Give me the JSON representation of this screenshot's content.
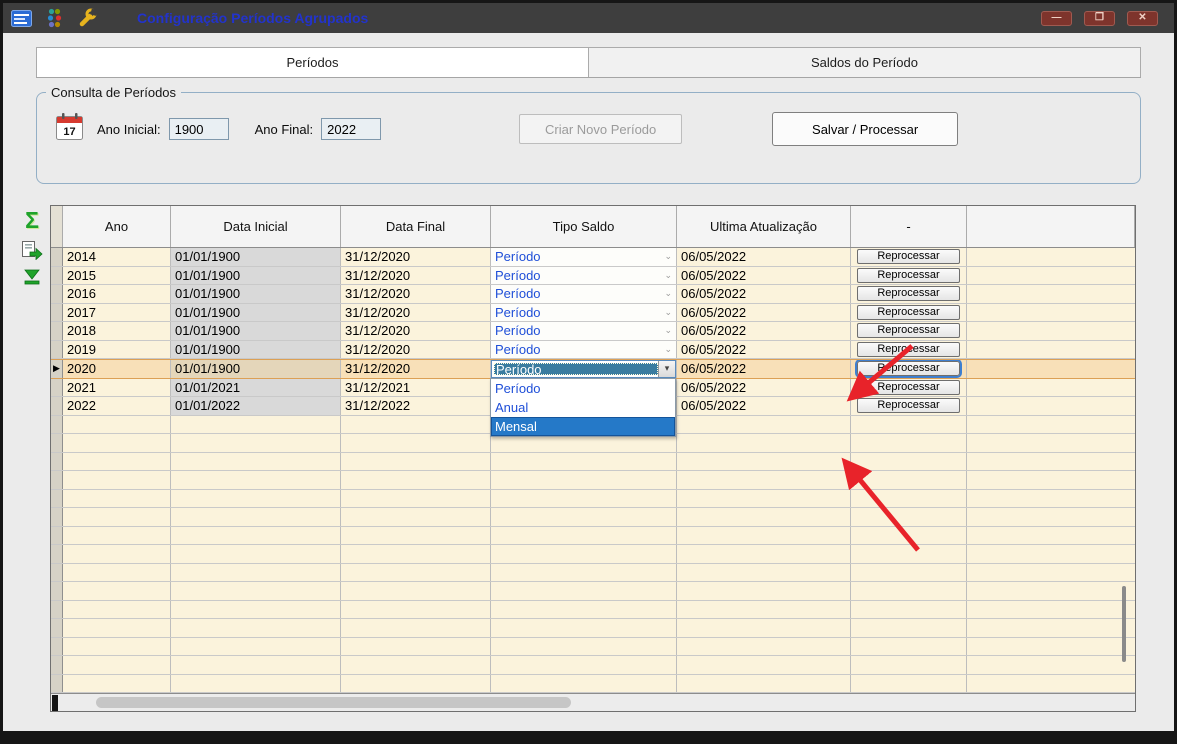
{
  "window": {
    "title": "Configuração Períodos Agrupados",
    "controls": [
      {
        "name": "minimize",
        "glyph": "—"
      },
      {
        "name": "maximize",
        "glyph": "❐"
      },
      {
        "name": "close",
        "glyph": "✕"
      }
    ]
  },
  "tabs": [
    {
      "label": "Períodos",
      "active": true
    },
    {
      "label": "Saldos do Período",
      "active": false
    }
  ],
  "consulta": {
    "legend": "Consulta de Períodos",
    "calendar_day": "17",
    "ano_inicial_label": "Ano Inicial:",
    "ano_inicial_value": "1900",
    "ano_final_label": "Ano Final:",
    "ano_final_value": "2022",
    "criar_novo_label": "Criar Novo Período",
    "salvar_label": "Salvar / Processar"
  },
  "toolbar_icons": [
    {
      "name": "sum-sigma-icon",
      "glyph": "Σ"
    },
    {
      "name": "export-record-icon"
    },
    {
      "name": "go-to-last-icon"
    }
  ],
  "grid": {
    "columns": [
      "Ano",
      "Data Inicial",
      "Data Final",
      "Tipo Saldo",
      "Ultima Atualização",
      "-"
    ],
    "action_label": "Reprocessar",
    "rows": [
      {
        "ano": "2014",
        "data_inicial": "01/01/1900",
        "data_final": "31/12/2020",
        "tipo_saldo": "Período",
        "ultima_atualizacao": "06/05/2022"
      },
      {
        "ano": "2015",
        "data_inicial": "01/01/1900",
        "data_final": "31/12/2020",
        "tipo_saldo": "Período",
        "ultima_atualizacao": "06/05/2022"
      },
      {
        "ano": "2016",
        "data_inicial": "01/01/1900",
        "data_final": "31/12/2020",
        "tipo_saldo": "Período",
        "ultima_atualizacao": "06/05/2022"
      },
      {
        "ano": "2017",
        "data_inicial": "01/01/1900",
        "data_final": "31/12/2020",
        "tipo_saldo": "Período",
        "ultima_atualizacao": "06/05/2022"
      },
      {
        "ano": "2018",
        "data_inicial": "01/01/1900",
        "data_final": "31/12/2020",
        "tipo_saldo": "Período",
        "ultima_atualizacao": "06/05/2022"
      },
      {
        "ano": "2019",
        "data_inicial": "01/01/1900",
        "data_final": "31/12/2020",
        "tipo_saldo": "Período",
        "ultima_atualizacao": "06/05/2022"
      },
      {
        "ano": "2020",
        "data_inicial": "01/01/1900",
        "data_final": "31/12/2020",
        "tipo_saldo": "Período",
        "ultima_atualizacao": "06/05/2022",
        "selected": true,
        "editing": true
      },
      {
        "ano": "2021",
        "data_inicial": "01/01/2021",
        "data_final": "31/12/2021",
        "tipo_saldo": "",
        "ultima_atualizacao": "06/05/2022"
      },
      {
        "ano": "2022",
        "data_inicial": "01/01/2022",
        "data_final": "31/12/2022",
        "tipo_saldo": "",
        "ultima_atualizacao": "06/05/2022"
      }
    ],
    "empty_rows": 15,
    "selected_row_marker": "▶"
  },
  "dropdown": {
    "value": "Período",
    "options": [
      {
        "label": "Período",
        "selected": false
      },
      {
        "label": "Anual",
        "selected": false
      },
      {
        "label": "Mensal",
        "selected": true
      }
    ]
  },
  "colors": {
    "selected_row": "#F8E0B8",
    "combo_text": "#1F4FD8",
    "dropdown_highlight": "#2579C8",
    "annotation_arrow": "#E8232A",
    "title_text": "#2233CC"
  }
}
